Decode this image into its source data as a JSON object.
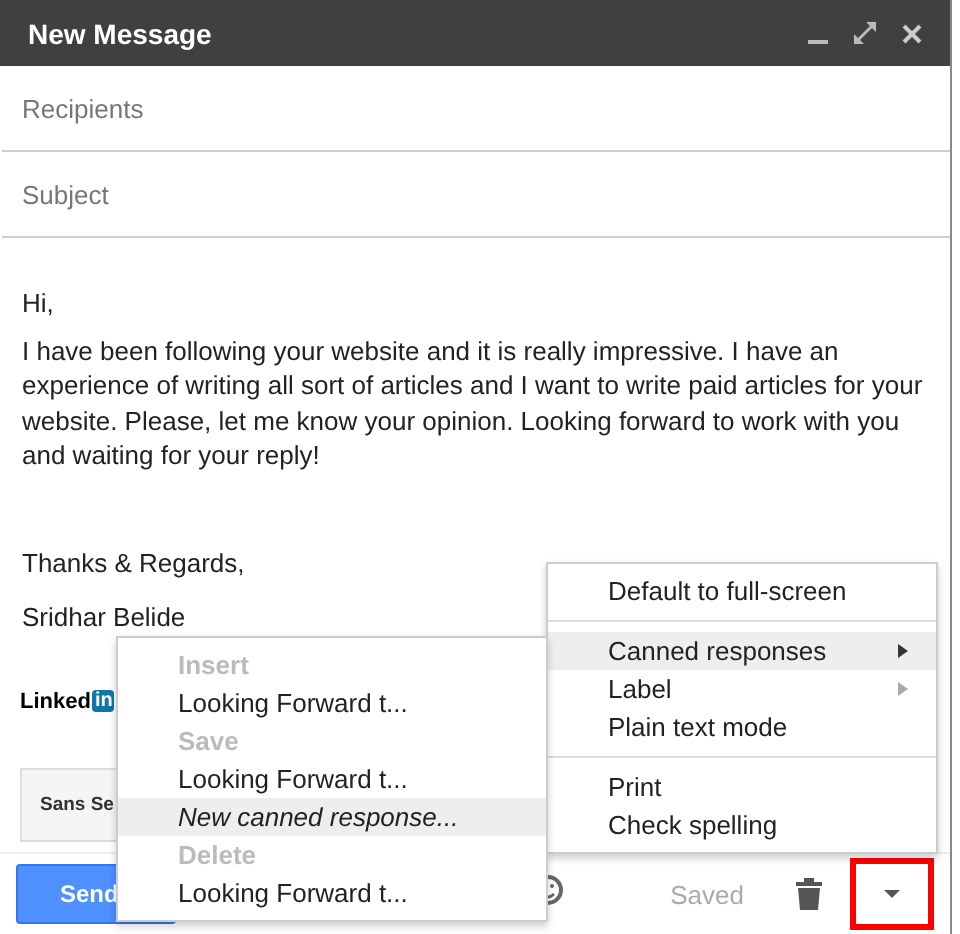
{
  "window": {
    "title": "New Message"
  },
  "recipients": {
    "placeholder": "Recipients"
  },
  "subject": {
    "placeholder": "Subject"
  },
  "body": {
    "paragraphs": [
      "Hi,",
      "I have been following your website and it is really impressive. I have an experience of writing all sort of articles and I want to write paid articles for your website. Please, let me know your opinion. Looking forward to work with you and waiting for your reply!",
      "Thanks & Regards,",
      "Sridhar Belide"
    ],
    "logo": {
      "text": "Linked",
      "badge": "in"
    }
  },
  "format_bar": {
    "font": "Sans Se"
  },
  "footer": {
    "send": "Send",
    "status": "Saved",
    "more_highlighted": true
  },
  "more_menu": {
    "sections": [
      [
        {
          "label": "Default to full-screen",
          "selected": false,
          "submenu": false
        }
      ],
      [
        {
          "label": "Canned responses",
          "selected": true,
          "submenu": true
        },
        {
          "label": "Label",
          "selected": false,
          "submenu": true
        },
        {
          "label": "Plain text mode",
          "selected": false,
          "submenu": false
        }
      ],
      [
        {
          "label": "Print",
          "selected": false,
          "submenu": false
        },
        {
          "label": "Check spelling",
          "selected": false,
          "submenu": false
        }
      ]
    ]
  },
  "canned_menu": {
    "items": [
      {
        "kind": "header",
        "label": "Insert"
      },
      {
        "kind": "item",
        "label": "Looking Forward t...",
        "selected": false
      },
      {
        "kind": "header",
        "label": "Save"
      },
      {
        "kind": "item",
        "label": "Looking Forward t...",
        "selected": false
      },
      {
        "kind": "new",
        "label": "New canned response...",
        "selected": true
      },
      {
        "kind": "header",
        "label": "Delete"
      },
      {
        "kind": "item",
        "label": "Looking Forward t...",
        "selected": false
      }
    ]
  }
}
